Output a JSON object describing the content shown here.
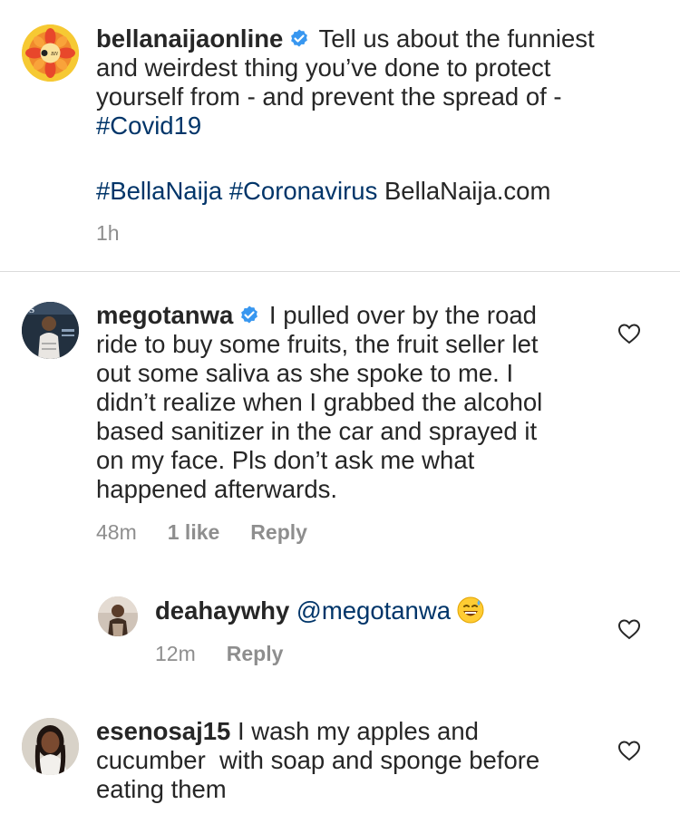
{
  "caption": {
    "username": "bellanaijaonline",
    "text_line1": "Tell us about the funniest",
    "text_line2": "and weirdest thing you’ve done to protect",
    "text_line3": "yourself from - and prevent the spread of -",
    "hashtag_covid": "#Covid19",
    "hashtag_bellanaija": "#BellaNaija",
    "hashtag_coronavirus": "#Coronavirus",
    "site": "BellaNaija.com",
    "time": "1h"
  },
  "comments": [
    {
      "username": "megotanwa",
      "lines": [
        "I pulled over by the road",
        "ride to buy some fruits, the fruit seller let",
        "out some saliva as she spoke to me. I",
        "didn’t realize when I grabbed the alcohol",
        "based sanitizer in the car and sprayed it",
        "on my face. Pls don’t ask me what",
        "happened afterwards."
      ],
      "time": "48m",
      "likes": "1 like",
      "reply": "Reply"
    },
    {
      "username": "deahaywhy",
      "mention": "@megotanwa",
      "emoji": "sweat-smile-emoji",
      "time": "12m",
      "reply": "Reply"
    },
    {
      "username": "esenosaj15",
      "lines": [
        "I wash my apples and",
        "cucumber  with soap and sponge before",
        "eating them"
      ]
    }
  ],
  "colors": {
    "text": "#262626",
    "hashtag": "#003569",
    "meta": "#8e8e8e",
    "verified": "#3897f0",
    "divider": "#dbdbdb"
  }
}
